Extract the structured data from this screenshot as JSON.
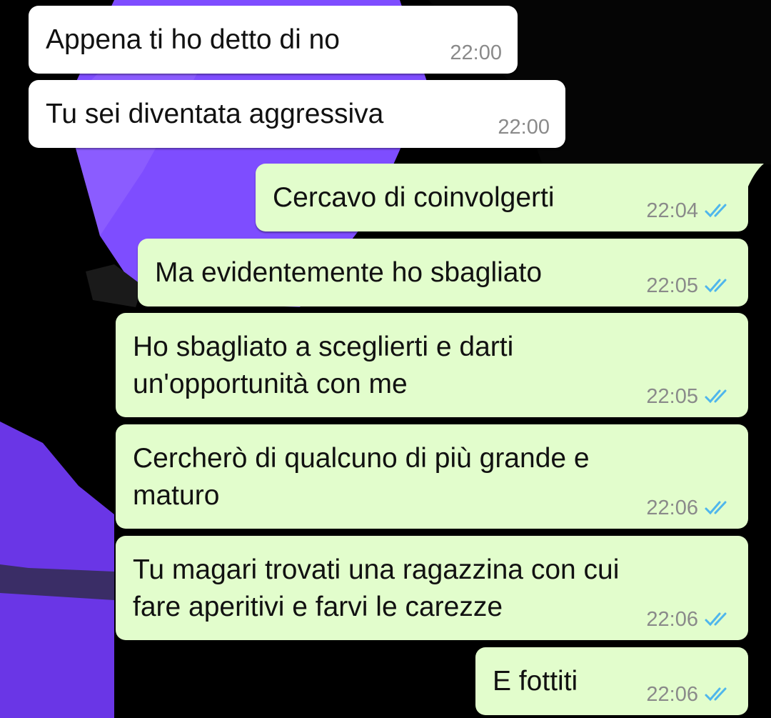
{
  "colors": {
    "incoming_bubble": "#ffffff",
    "outgoing_bubble": "#e2fdcc",
    "timestamp": "#8a8a8a",
    "read_ticks": "#4fb6ec",
    "wallpaper_purple": "#7e4dff"
  },
  "messages": [
    {
      "direction": "incoming",
      "text": "Appena ti ho detto di no",
      "time": "22:00"
    },
    {
      "direction": "incoming",
      "text": "Tu sei diventata aggressiva",
      "time": "22:00"
    },
    {
      "direction": "outgoing",
      "text": "Cercavo di coinvolgerti",
      "time": "22:04",
      "status": "read"
    },
    {
      "direction": "outgoing",
      "text": "Ma evidentemente ho sbagliato",
      "time": "22:05",
      "status": "read"
    },
    {
      "direction": "outgoing",
      "text": "Ho sbagliato a sceglierti e darti\nun'opportunità con me",
      "time": "22:05",
      "status": "read"
    },
    {
      "direction": "outgoing",
      "text": "Cercherò di qualcuno di più grande e\nmaturo",
      "time": "22:06",
      "status": "read"
    },
    {
      "direction": "outgoing",
      "text": "Tu magari trovati una ragazzina con cui\nfare aperitivi e farvi le carezze",
      "time": "22:06",
      "status": "read"
    },
    {
      "direction": "outgoing",
      "text": "E fottiti",
      "time": "22:06",
      "status": "read"
    }
  ]
}
